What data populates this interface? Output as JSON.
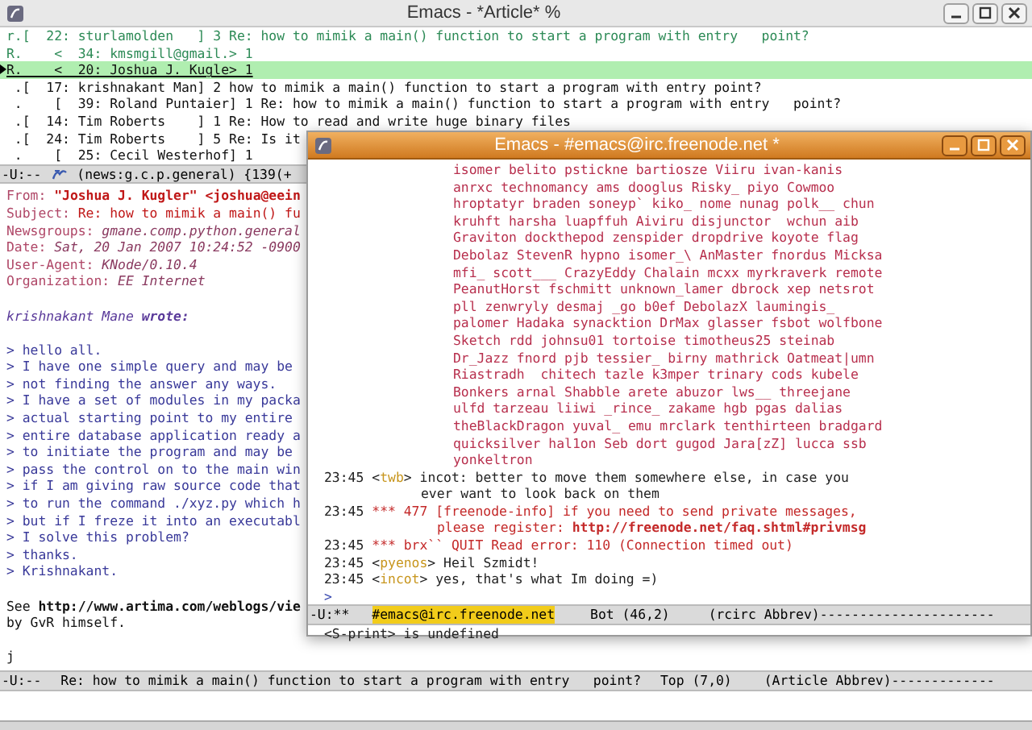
{
  "main_window": {
    "title": "Emacs - *Article* %",
    "summary": [
      {
        "text": "r.[  22: sturlamolden   ] 3 Re: how to mimik a main() function to start a program with entry   point?",
        "color": "#2e8b57",
        "selected": false
      },
      {
        "text": "R.    <  34: kmsmgill@gmail.> 1",
        "color": "#2e8b57",
        "selected": false
      },
      {
        "text": "R.    <  20: Joshua J. Kugle> 1",
        "color": "#111111",
        "selected": true
      },
      {
        "text": " .[  17: krishnakant Man] 2 how to mimik a main() function to start a program with entry point?",
        "color": "#111111",
        "selected": false
      },
      {
        "text": " .    [  39: Roland Puntaier] 1 Re: how to mimik a main() function to start a program with entry   point?",
        "color": "#111111",
        "selected": false
      },
      {
        "text": " .[  14: Tim Roberts    ] 1 Re: How to read and write huge binary files",
        "color": "#111111",
        "selected": false
      },
      {
        "text": " .[  24: Tim Roberts    ] 5 Re: Is it",
        "color": "#111111",
        "selected": false
      },
      {
        "text": " .    [  25: Cecil Westerhof] 1",
        "color": "#111111",
        "selected": false
      }
    ],
    "summary_modeline": {
      "status": "-U:--",
      "buffer": "(news:g.c.p.general) {139(+"
    },
    "headers": [
      {
        "name": "From:",
        "value": "\"Joshua J. Kugler\" <joshua@eein",
        "kind": "from"
      },
      {
        "name": "Subject:",
        "value": "Re: how to mimik a main() fu",
        "kind": "subject"
      },
      {
        "name": "Newsgroups:",
        "value": "gmane.comp.python.general",
        "kind": "other"
      },
      {
        "name": "Date:",
        "value": "Sat, 20 Jan 2007 10:24:52 -0900",
        "kind": "other"
      },
      {
        "name": "User-Agent:",
        "value": "KNode/0.10.4",
        "kind": "other"
      },
      {
        "name": "Organization:",
        "value": "EE Internet",
        "kind": "other"
      }
    ],
    "body": [
      {
        "kind": "blank"
      },
      {
        "kind": "attribution",
        "text": "krishnakant Mane **wrote:**"
      },
      {
        "kind": "blank"
      },
      {
        "kind": "quote",
        "text": "> hello all."
      },
      {
        "kind": "quote",
        "text": "> I have one simple query and may be"
      },
      {
        "kind": "quote",
        "text": "> not finding the answer any ways."
      },
      {
        "kind": "quote",
        "text": "> I have a set of modules in my packa"
      },
      {
        "kind": "quote",
        "text": "> actual starting point to my entire"
      },
      {
        "kind": "quote",
        "text": "> entire database application ready a"
      },
      {
        "kind": "quote",
        "text": "> to initiate the program and may be"
      },
      {
        "kind": "quote",
        "text": "> pass the control on to the main win"
      },
      {
        "kind": "quote",
        "text": "> if I am giving raw source code that"
      },
      {
        "kind": "quote",
        "text": "> to run the command ./xyz.py which h"
      },
      {
        "kind": "quote",
        "text": "> but if I freze it into an executabl"
      },
      {
        "kind": "quote",
        "text": "> I solve this problem?"
      },
      {
        "kind": "quote",
        "text": "> thanks."
      },
      {
        "kind": "quote",
        "text": "> Krishnakant."
      },
      {
        "kind": "blank"
      },
      {
        "kind": "text",
        "text": "See **http://www.artima.com/weblogs/vie**"
      },
      {
        "kind": "text",
        "text": "by GvR himself."
      },
      {
        "kind": "blank"
      },
      {
        "kind": "text",
        "text": "j"
      }
    ],
    "article_modeline": {
      "status": "-U:--",
      "buffer": "Re: how to mimik a main() function to start a program with entry   point?",
      "position": "Top (7,0)",
      "modes": "(Article Abbrev)-------------"
    }
  },
  "irc_window": {
    "title": "Emacs - #emacs@irc.freenode.net *",
    "lines": [
      {
        "kind": "names",
        "text": "isomer belito pstickne bartiosze Viiru ivan-kanis"
      },
      {
        "kind": "names",
        "text": "anrxc technomancy ams dooglus Risky_ piyo Cowmoo"
      },
      {
        "kind": "names",
        "text": "hroptatyr braden soneyp` kiko_ nome nunag polk__ chun"
      },
      {
        "kind": "names",
        "text": "kruhft harsha luapffuh Aiviru disjunctor  wchun aib"
      },
      {
        "kind": "names",
        "text": "Graviton dockthepod zenspider dropdrive koyote flag"
      },
      {
        "kind": "names",
        "text": "Debolaz StevenR hypno isomer_\\ AnMaster fnordus Micksa"
      },
      {
        "kind": "names",
        "text": "mfi_ scott___ CrazyEddy Chalain mcxx myrkraverk remote"
      },
      {
        "kind": "names",
        "text": "PeanutHorst fschmitt unknown_lamer dbrock xep netsrot"
      },
      {
        "kind": "names",
        "text": "pll zenwryly desmaj _go b0ef DebolazX laumingis_"
      },
      {
        "kind": "names",
        "text": "palomer Hadaka synacktion DrMax glasser fsbot wolfbone"
      },
      {
        "kind": "names",
        "text": "Sketch rdd johnsu01 tortoise timotheus25 steinab"
      },
      {
        "kind": "names",
        "text": "Dr_Jazz fnord pjb tessier_ birny mathrick Oatmeat|umn"
      },
      {
        "kind": "names",
        "text": "Riastradh  chitech tazle k3mper trinary cods kubele"
      },
      {
        "kind": "names",
        "text": "Bonkers arnal Shabble arete abuzor lws__ threejane"
      },
      {
        "kind": "names",
        "text": "ulfd tarzeau liiwi _rince_ zakame hgb pgas dalias"
      },
      {
        "kind": "names",
        "text": "theBlackDragon yuval_ emu mrclark tenthirteen bradgard"
      },
      {
        "kind": "names",
        "text": "quicksilver hal1on Seb dort gugod Jara[zZ] lucca ssb"
      },
      {
        "kind": "names",
        "text": "yonkeltron"
      },
      {
        "kind": "message",
        "time": "23:45",
        "open": "<",
        "nick": "twb",
        "close": ">",
        "text": "incot: better to move them somewhere else, in case you"
      },
      {
        "kind": "message_cont",
        "text": "ever want to look back on them"
      },
      {
        "kind": "notice",
        "time": "23:45",
        "text": "*** 477 [freenode-info] if you need to send private messages,"
      },
      {
        "kind": "notice_cont",
        "text": "please register: **http://freenode.net/faq.shtml#privmsg**"
      },
      {
        "kind": "notice",
        "time": "23:45",
        "text": "*** brx`` QUIT Read error: 110 (Connection timed out)"
      },
      {
        "kind": "message",
        "time": "23:45",
        "open": "<",
        "nick": "pyenos",
        "close": ">",
        "text": "Heil Szmidt!"
      },
      {
        "kind": "message",
        "time": "23:45",
        "open": "<",
        "nick": "incot",
        "close": ">",
        "text": "yes, that's what Im doing =)"
      },
      {
        "kind": "prompt",
        "text": ">"
      }
    ],
    "modeline": {
      "status": "-U:**",
      "channel": "#emacs@irc.freenode.net",
      "position": "Bot (46,2)",
      "modes": "(rcirc Abbrev)----------------------"
    },
    "echo": "<S-print> is undefined"
  }
}
